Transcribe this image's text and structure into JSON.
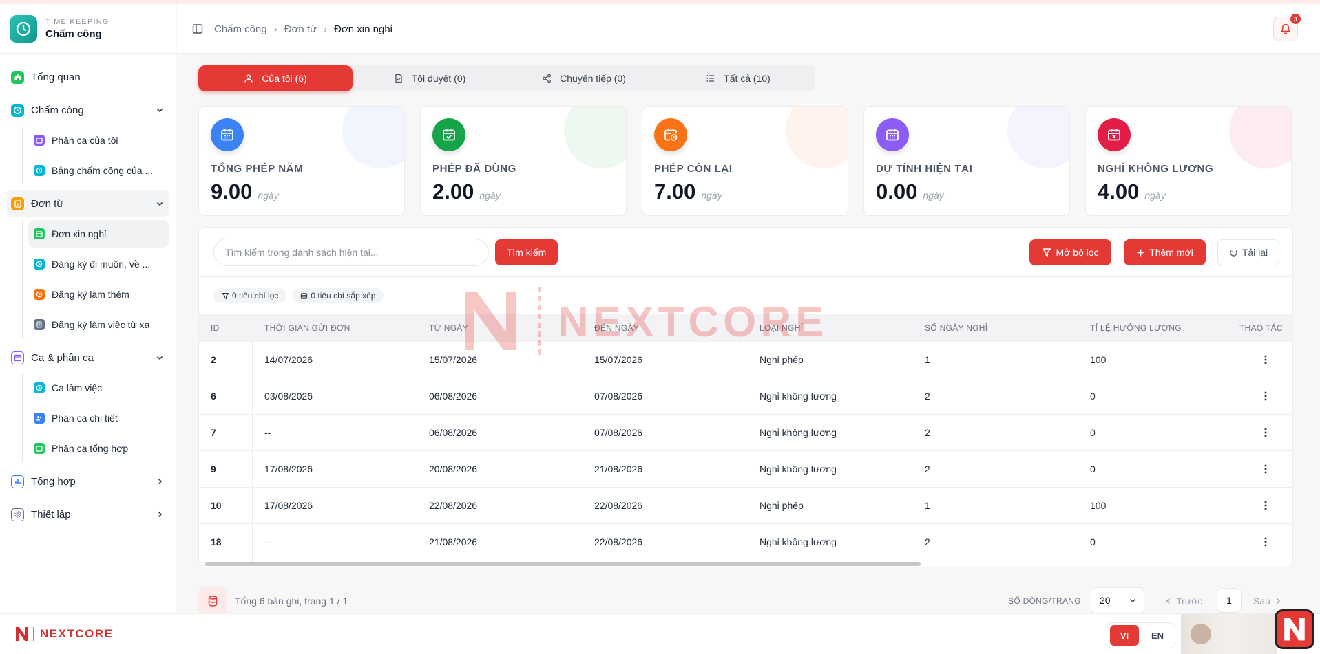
{
  "brand": {
    "subtitle": "TIME KEEPING",
    "title": "Chấm công"
  },
  "sidebar": {
    "groups": [
      {
        "label": "Tổng quan",
        "icon": "home-icon",
        "color": "#22c55e"
      },
      {
        "label": "Chấm công",
        "icon": "clock-icon",
        "color": "#06b6d4",
        "items": [
          {
            "label": "Phân ca của tôi",
            "icon": "calendar-icon",
            "color": "#8b5cf6"
          },
          {
            "label": "Bảng chấm công của ...",
            "icon": "clock-icon",
            "color": "#06b6d4"
          }
        ]
      },
      {
        "label": "Đơn từ",
        "icon": "clipboard-check-icon",
        "color": "#f59e0b",
        "items": [
          {
            "label": "Đơn xin nghỉ",
            "icon": "calendar-icon",
            "color": "#22c55e"
          },
          {
            "label": "Đăng ký đi muộn, về ...",
            "icon": "clock-icon",
            "color": "#06b6d4"
          },
          {
            "label": "Đăng ký làm thêm",
            "icon": "clock-icon",
            "color": "#f97316"
          },
          {
            "label": "Đăng ký làm việc từ xa",
            "icon": "document-icon",
            "color": "#64748b"
          }
        ]
      },
      {
        "label": "Ca & phân ca",
        "icon": "calendar-icon",
        "color": "#8b5cf6",
        "items": [
          {
            "label": "Ca làm việc",
            "icon": "clock-icon",
            "color": "#06b6d4"
          },
          {
            "label": "Phân ca chi tiết",
            "icon": "users-icon",
            "color": "#3b82f6"
          },
          {
            "label": "Phân ca tổng hợp",
            "icon": "calendar-icon",
            "color": "#22c55e"
          }
        ]
      },
      {
        "label": "Tổng hợp",
        "icon": "bar-chart-icon",
        "color": "#3b82f6"
      },
      {
        "label": "Thiết lập",
        "icon": "gear-icon",
        "color": "#64748b"
      }
    ]
  },
  "breadcrumb": [
    "Chấm công",
    "Đơn từ",
    "Đơn xin nghỉ"
  ],
  "notifications": {
    "count": "3"
  },
  "tabs": [
    {
      "label": "Của tôi (6)",
      "icon": "user-icon"
    },
    {
      "label": "Tôi duyệt (0)",
      "icon": "file-check-icon"
    },
    {
      "label": "Chuyển tiếp (0)",
      "icon": "share-icon"
    },
    {
      "label": "Tất cả (10)",
      "icon": "list-icon"
    }
  ],
  "stats": [
    {
      "title": "TỔNG PHÉP NĂM",
      "value": "9.00",
      "unit": "ngày",
      "color": "#3b82f6",
      "icon": "calendar-icon"
    },
    {
      "title": "PHÉP ĐÃ DÙNG",
      "value": "2.00",
      "unit": "ngày",
      "color": "#16a34a",
      "icon": "calendar-check-icon"
    },
    {
      "title": "PHÉP CÒN LẠI",
      "value": "7.00",
      "unit": "ngày",
      "color": "#f97316",
      "icon": "calendar-clock-icon"
    },
    {
      "title": "DỰ TÍNH HIỆN TẠI",
      "value": "0.00",
      "unit": "ngày",
      "color": "#8b5cf6",
      "icon": "calendar-icon"
    },
    {
      "title": "NGHỈ KHÔNG LƯƠNG",
      "value": "4.00",
      "unit": "ngày",
      "color": "#e11d48",
      "icon": "calendar-x-icon"
    }
  ],
  "toolbar": {
    "search_placeholder": "Tìm kiếm trong danh sách hiện tại...",
    "search_label": "Tìm kiếm",
    "filter_label": "Mở bộ lọc",
    "add_label": "Thêm mới",
    "reload_label": "Tải lại"
  },
  "chips": {
    "filter": "0 tiêu chí lọc",
    "sort": "0 tiêu chí sắp xếp"
  },
  "table": {
    "columns": [
      "ID",
      "THỜI GIAN GỬI ĐƠN",
      "TỪ NGÀY",
      "ĐẾN NGÀY",
      "LOẠI NGHỈ",
      "SỐ NGÀY NGHỈ",
      "TỈ LỆ HƯỞNG LƯƠNG",
      "THAO TÁC"
    ],
    "rows": [
      [
        "2",
        "14/07/2026",
        "15/07/2026",
        "15/07/2026",
        "Nghỉ phép",
        "1",
        "100"
      ],
      [
        "6",
        "03/08/2026",
        "06/08/2026",
        "07/08/2026",
        "Nghỉ không lương",
        "2",
        "0"
      ],
      [
        "7",
        "--",
        "06/08/2026",
        "07/08/2026",
        "Nghỉ không lương",
        "2",
        "0"
      ],
      [
        "9",
        "17/08/2026",
        "20/08/2026",
        "21/08/2026",
        "Nghỉ không lương",
        "2",
        "0"
      ],
      [
        "10",
        "17/08/2026",
        "22/08/2026",
        "22/08/2026",
        "Nghỉ phép",
        "1",
        "100"
      ],
      [
        "18",
        "--",
        "21/08/2026",
        "22/08/2026",
        "Nghỉ không lương",
        "2",
        "0"
      ]
    ]
  },
  "watermark": "NEXTCORE",
  "footer": {
    "summary": "Tổng 6 bản ghi, trang 1 / 1",
    "rows_label": "SỐ DÒNG/TRANG",
    "rows_value": "20",
    "prev": "Trước",
    "page": "1",
    "next": "Sau"
  },
  "bottom": {
    "logo_text": "NEXTCORE",
    "lang_vi": "VI",
    "lang_en": "EN"
  }
}
